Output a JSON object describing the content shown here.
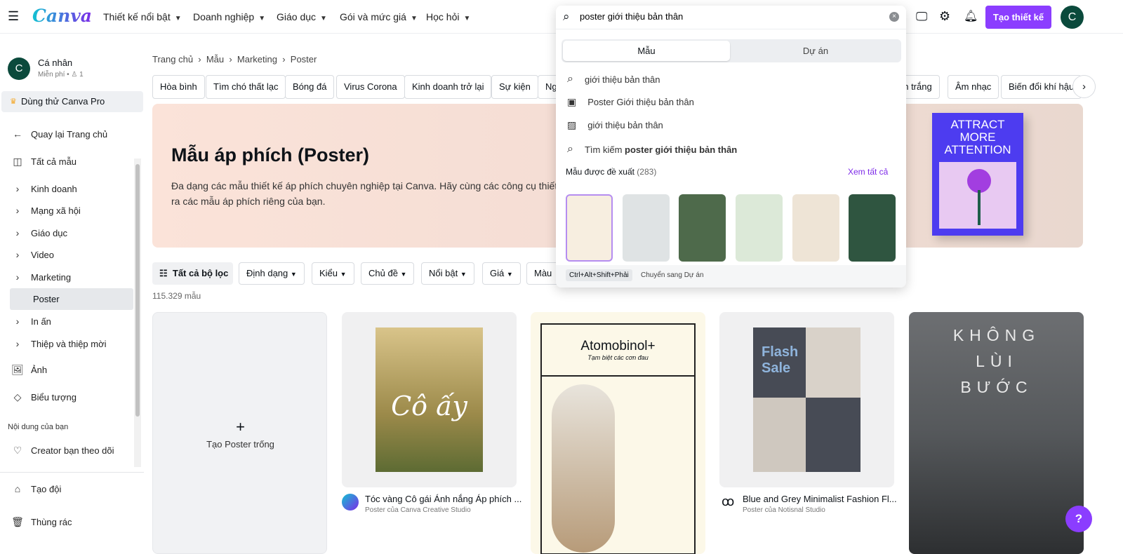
{
  "header": {
    "logo": "Canva",
    "nav": [
      "Thiết kế nổi bật",
      "Doanh nghiệp",
      "Giáo dục",
      "Gói và mức giá",
      "Học hỏi"
    ],
    "search_value": "poster giới thiệu bản thân",
    "create_label": "Tạo thiết kế",
    "avatar": "C",
    "accent": "#8b3dff"
  },
  "sidebar": {
    "account_name": "Cá nhân",
    "account_plan": "Miễn phí",
    "member_count": "1",
    "avatar": "C",
    "pro_trial": "Dùng thử Canva Pro",
    "back": "Quay lại Trang chủ",
    "all_templates": "Tất cả mẫu",
    "categories": [
      "Kinh doanh",
      "Mạng xã hội",
      "Giáo dục",
      "Video",
      "Marketing",
      "Poster",
      "In ấn",
      "Thiệp và thiệp mời"
    ],
    "photos": "Ảnh",
    "icons": "Biểu tượng",
    "your_content": "Nội dung của bạn",
    "creators": "Creator bạn theo dõi",
    "team": "Tạo đội",
    "trash": "Thùng rác"
  },
  "breadcrumb": [
    "Trang chủ",
    "Mẫu",
    "Marketing",
    "Poster"
  ],
  "chips": [
    "Hòa bình",
    "Tìm chó thất lạc",
    "Bóng đá",
    "Virus Corona",
    "Kinh doanh trở lại",
    "Sự kiện",
    "Ng",
    "en trắng",
    "Âm nhạc",
    "Biến đổi khí hậu"
  ],
  "hero": {
    "title": "Mẫu áp phích (Poster)",
    "desc_line1": "Đa dạng các mẫu thiết kế áp phích chuyên nghiệp tại Canva. Hãy cùng các công cụ thiết",
    "desc_line2": "ra các mẫu áp phích riêng của bạn.",
    "poster_text": "ATTRACT MORE ATTENTION"
  },
  "filters": {
    "all": "Tất cả bộ lọc",
    "items": [
      "Định dạng",
      "Kiểu",
      "Chủ đề",
      "Nổi bật",
      "Giá",
      "Màu"
    ],
    "count": "115.329 mẫu"
  },
  "cards": {
    "blank": "Tạo Poster trống",
    "items": [
      {
        "title": "Tóc vàng Cô gái Ánh nắng Áp phích ...",
        "author": "Poster của Canva Creative Studio",
        "art": "Cô ấy"
      },
      {
        "art": "Atomobinol+",
        "art_sub": "Tạm biệt các cơn đau"
      },
      {
        "title": "Blue and Grey Minimalist Fashion Fl...",
        "author": "Poster của Notisnal Studio",
        "art": "Flash Sale"
      },
      {
        "art": "KHÔNG LÙI BƯỚC"
      }
    ]
  },
  "dropdown": {
    "tabs": [
      "Mẫu",
      "Dự án"
    ],
    "suggestions": [
      {
        "icon": "search",
        "text": "giới thiệu bản thân"
      },
      {
        "icon": "template",
        "text": "Poster Giới thiệu bản thân"
      },
      {
        "icon": "image",
        "text": "giới thiệu bản thân"
      }
    ],
    "search_prefix": "Tìm kiếm",
    "search_bold": "poster giới thiệu bản thân",
    "recommended": "Mẫu được đề xuất",
    "recommended_count": "(283)",
    "see_all": "Xem tất cả",
    "shortcut": "Ctrl+Alt+Shift+Phải",
    "shortcut_label": "Chuyển sang Dự án"
  },
  "help": "?"
}
